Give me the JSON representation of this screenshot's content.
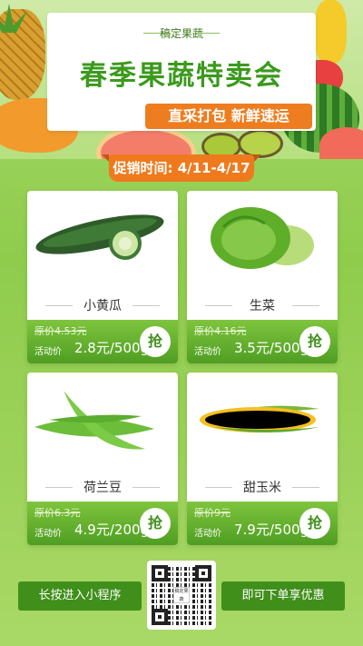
{
  "hero": {
    "brand": "稿定果蔬",
    "title": "春季果蔬特卖会",
    "subtitle": "直采打包  新鲜速运"
  },
  "promo": {
    "date_label": "促销时间: 4/11-4/17"
  },
  "products": [
    {
      "name": "小黄瓜",
      "original_price": "原价4.53元",
      "activity_label": "活动价",
      "activity_price": "2.8元/500g",
      "grab_label": "抢",
      "icon": "cucumber-icon"
    },
    {
      "name": "生菜",
      "original_price": "原价4.16元",
      "activity_label": "活动价",
      "activity_price": "3.5元/500g",
      "grab_label": "抢",
      "icon": "lettuce-icon"
    },
    {
      "name": "荷兰豆",
      "original_price": "原价6.3元",
      "activity_label": "活动价",
      "activity_price": "4.9元/200g",
      "grab_label": "抢",
      "icon": "snow-pea-icon"
    },
    {
      "name": "甜玉米",
      "original_price": "原价9元",
      "activity_label": "活动价",
      "activity_price": "7.9元/500g",
      "grab_label": "抢",
      "icon": "corn-icon"
    }
  ],
  "footer": {
    "left_label": "长按进入小程序",
    "right_label": "即可下单享优惠",
    "qr_center_text": "稿定果蔬"
  },
  "colors": {
    "brand_green": "#3b9a1c",
    "accent_orange": "#ee7d1f",
    "price_bar_green": "#4f9e22"
  }
}
